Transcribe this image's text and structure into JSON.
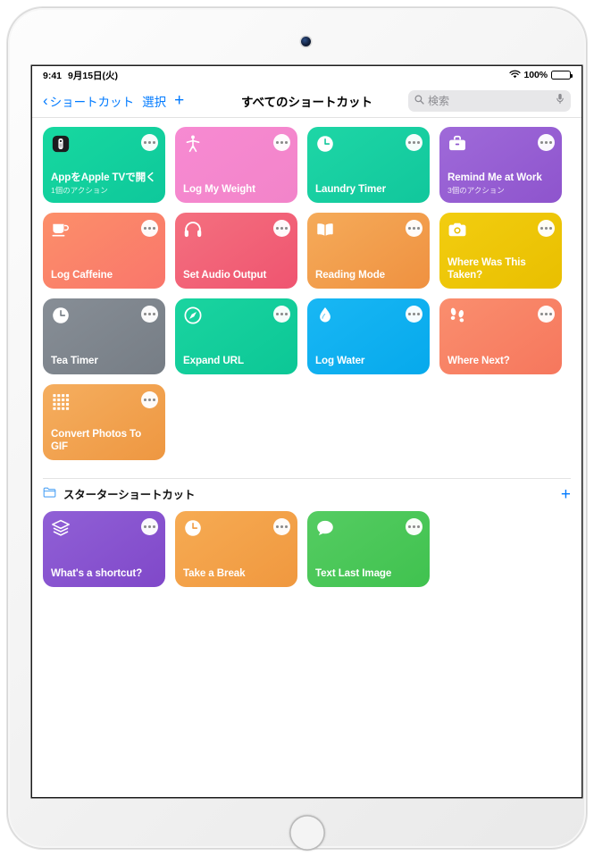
{
  "device": {
    "camera": "camera-icon",
    "home_button": "home-button"
  },
  "status_bar": {
    "time": "9:41",
    "date": "9月15日(火)",
    "wifi": "wifi-icon",
    "battery_percent": "100%",
    "battery": "battery-full-icon"
  },
  "nav": {
    "back_label": "ショートカット",
    "select_label": "選択",
    "add_label": "+",
    "title": "すべてのショートカット"
  },
  "search": {
    "placeholder": "検索",
    "value": "",
    "icon": "magnifier-icon",
    "mic": "microphone-icon"
  },
  "colors": {
    "accent_blue": "#007aff",
    "card_teal": "#14d39f",
    "card_pink": "#f588cd",
    "card_green_teal": "#1dcfa2",
    "card_purple": "#9a62d6",
    "card_salmon": "#fb8268",
    "card_red_pink": "#f2607a",
    "card_orange": "#f2a04a",
    "card_yellow": "#edc80c",
    "card_gray": "#7d848c",
    "card_mint": "#15cf9c",
    "card_blue": "#12b0f0",
    "card_coral": "#f88263",
    "card_tangerine": "#f0a050",
    "card_violet": "#8a52cc",
    "card_amber": "#f2a43e",
    "card_grass": "#4cc75a"
  },
  "all_shortcuts": {
    "cards": [
      {
        "title": "AppをApple TVで開く",
        "subtitle": "1個のアクション",
        "icon": "remote-control-icon",
        "color_start": "#17d8a0",
        "color_end": "#0ec89b",
        "menu": "more-options"
      },
      {
        "title": "Log My Weight",
        "subtitle": "",
        "icon": "person-figure-icon",
        "color_start": "#f78ad2",
        "color_end": "#f284c9",
        "menu": "more-options"
      },
      {
        "title": "Laundry Timer",
        "subtitle": "",
        "icon": "clock-icon",
        "color_start": "#1ed6a6",
        "color_end": "#11c79c",
        "menu": "more-options"
      },
      {
        "title": "Remind Me at Work",
        "subtitle": "3個のアクション",
        "icon": "briefcase-icon",
        "color_start": "#9f6ad9",
        "color_end": "#8e54cd",
        "menu": "more-options"
      },
      {
        "title": "Log Caffeine",
        "subtitle": "",
        "icon": "coffee-cup-icon",
        "color_start": "#fc8f6a",
        "color_end": "#f9766b",
        "menu": "more-options"
      },
      {
        "title": "Set Audio Output",
        "subtitle": "",
        "icon": "headphones-icon",
        "color_start": "#f4707f",
        "color_end": "#ef5470",
        "menu": "more-options"
      },
      {
        "title": "Reading Mode",
        "subtitle": "",
        "icon": "open-book-icon",
        "color_start": "#f5ab5a",
        "color_end": "#ef9140",
        "menu": "more-options"
      },
      {
        "title": "Where Was This Taken?",
        "subtitle": "",
        "icon": "camera-icon",
        "color_start": "#f2cd10",
        "color_end": "#e9bf00",
        "menu": "more-options"
      },
      {
        "title": "Tea Timer",
        "subtitle": "",
        "icon": "clock-icon",
        "color_start": "#878e96",
        "color_end": "#767d85",
        "menu": "more-options"
      },
      {
        "title": "Expand URL",
        "subtitle": "",
        "icon": "compass-icon",
        "color_start": "#1ad4a0",
        "color_end": "#0cc796",
        "menu": "more-options"
      },
      {
        "title": "Log Water",
        "subtitle": "",
        "icon": "water-drop-icon",
        "color_start": "#19b7f4",
        "color_end": "#06a9ec",
        "menu": "more-options"
      },
      {
        "title": "Where Next?",
        "subtitle": "",
        "icon": "footprints-icon",
        "color_start": "#fa8e6e",
        "color_end": "#f6775d",
        "menu": "more-options"
      },
      {
        "title": "Convert Photos To GIF",
        "subtitle": "",
        "icon": "grid-dots-icon",
        "color_start": "#f5ae5f",
        "color_end": "#ee9741",
        "menu": "more-options"
      }
    ]
  },
  "starter_section": {
    "folder_icon": "folder-icon",
    "title": "スターターショートカット",
    "add_label": "+",
    "cards": [
      {
        "title": "What's a shortcut?",
        "subtitle": "",
        "icon": "layers-icon",
        "color_start": "#9060d6",
        "color_end": "#8048c9",
        "menu": "more-options"
      },
      {
        "title": "Take a Break",
        "subtitle": "",
        "icon": "clock-icon",
        "color_start": "#f6ab53",
        "color_end": "#f0983f",
        "menu": "more-options"
      },
      {
        "title": "Text Last Image",
        "subtitle": "",
        "icon": "speech-bubble-icon",
        "color_start": "#55cc62",
        "color_end": "#40c24f",
        "menu": "more-options"
      }
    ]
  }
}
